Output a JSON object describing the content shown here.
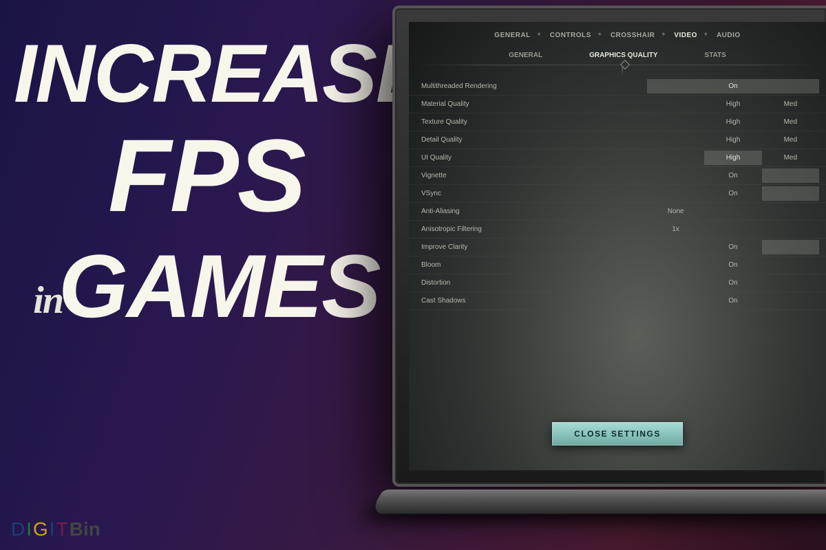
{
  "headline": {
    "line1": "INCREASE",
    "line2": "FPS",
    "line3_prefix": "in",
    "line3": "GAMES"
  },
  "logo": {
    "chars": [
      "D",
      "I",
      "G",
      "I",
      "T"
    ],
    "suffix": "Bin"
  },
  "tabs_primary": [
    {
      "label": "GENERAL",
      "active": false
    },
    {
      "label": "CONTROLS",
      "active": false
    },
    {
      "label": "CROSSHAIR",
      "active": false
    },
    {
      "label": "VIDEO",
      "active": true
    },
    {
      "label": "AUDIO",
      "active": false
    }
  ],
  "tabs_sub": [
    {
      "label": "GENERAL",
      "active": false
    },
    {
      "label": "GRAPHICS QUALITY",
      "active": true
    },
    {
      "label": "STATS",
      "active": false
    }
  ],
  "settings": [
    {
      "label": "Multithreaded Rendering",
      "opts": [
        {
          "text": "On",
          "selected": true,
          "wide": true
        }
      ]
    },
    {
      "label": "Material Quality",
      "opts": [
        {
          "text": "",
          "selected": false
        },
        {
          "text": "High",
          "selected": false
        },
        {
          "text": "Med",
          "selected": false
        }
      ]
    },
    {
      "label": "Texture Quality",
      "opts": [
        {
          "text": "",
          "selected": false
        },
        {
          "text": "High",
          "selected": false
        },
        {
          "text": "Med",
          "selected": false
        }
      ]
    },
    {
      "label": "Detail Quality",
      "opts": [
        {
          "text": "",
          "selected": false
        },
        {
          "text": "High",
          "selected": false
        },
        {
          "text": "Med",
          "selected": false
        }
      ]
    },
    {
      "label": "UI Quality",
      "opts": [
        {
          "text": "",
          "selected": false
        },
        {
          "text": "High",
          "selected": true
        },
        {
          "text": "Med",
          "selected": false
        }
      ]
    },
    {
      "label": "Vignette",
      "opts": [
        {
          "text": "",
          "selected": false
        },
        {
          "text": "On",
          "selected": false
        },
        {
          "text": "",
          "selected": true
        }
      ]
    },
    {
      "label": "VSync",
      "opts": [
        {
          "text": "",
          "selected": false
        },
        {
          "text": "On",
          "selected": false
        },
        {
          "text": "",
          "selected": true
        }
      ]
    },
    {
      "label": "Anti-Aliasing",
      "opts": [
        {
          "text": "None",
          "selected": false
        },
        {
          "text": "",
          "selected": false
        },
        {
          "text": "",
          "selected": false
        }
      ]
    },
    {
      "label": "Anisotropic Filtering",
      "opts": [
        {
          "text": "1x",
          "selected": false
        },
        {
          "text": "",
          "selected": false
        },
        {
          "text": "",
          "selected": false
        }
      ]
    },
    {
      "label": "Improve Clarity",
      "opts": [
        {
          "text": "",
          "selected": false
        },
        {
          "text": "On",
          "selected": false
        },
        {
          "text": "",
          "selected": true
        }
      ]
    },
    {
      "label": "Bloom",
      "opts": [
        {
          "text": "",
          "selected": false
        },
        {
          "text": "On",
          "selected": false
        },
        {
          "text": "",
          "selected": false
        }
      ]
    },
    {
      "label": "Distortion",
      "opts": [
        {
          "text": "",
          "selected": false
        },
        {
          "text": "On",
          "selected": false
        },
        {
          "text": "",
          "selected": false
        }
      ]
    },
    {
      "label": "Cast Shadows",
      "opts": [
        {
          "text": "",
          "selected": false
        },
        {
          "text": "On",
          "selected": false
        },
        {
          "text": "",
          "selected": false
        }
      ]
    }
  ],
  "close_label": "CLOSE SETTINGS"
}
